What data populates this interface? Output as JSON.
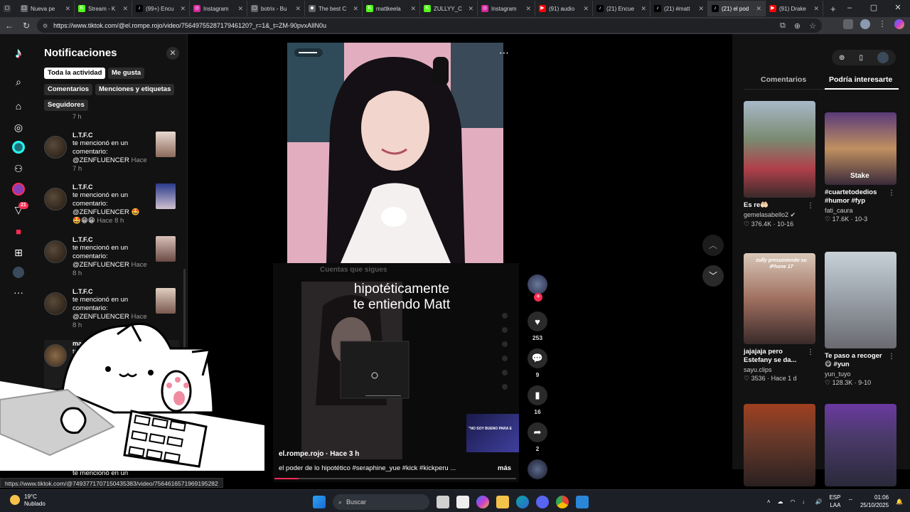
{
  "browser": {
    "tabs": [
      {
        "title": "Nueva pe",
        "color": "#5f6368",
        "glyph": "▢"
      },
      {
        "title": "Stream - K",
        "color": "#53fc18",
        "glyph": "K"
      },
      {
        "title": "(99+) Encu",
        "color": "#000000",
        "glyph": "♪"
      },
      {
        "title": "Instagram",
        "color": "#d6249f",
        "glyph": "◎"
      },
      {
        "title": "botrix - Bu",
        "color": "#5f6368",
        "glyph": "▢"
      },
      {
        "title": "The best C",
        "color": "#5f6368",
        "glyph": "◆"
      },
      {
        "title": "mattkeela",
        "color": "#53fc18",
        "glyph": "K"
      },
      {
        "title": "ZULLYY_C",
        "color": "#53fc18",
        "glyph": "K"
      },
      {
        "title": "Instagram",
        "color": "#d6249f",
        "glyph": "◎"
      },
      {
        "title": "(91) audio",
        "color": "#ff0000",
        "glyph": "▶"
      },
      {
        "title": "(21) Encue",
        "color": "#000000",
        "glyph": "♪"
      },
      {
        "title": "(21) #matt",
        "color": "#000000",
        "glyph": "♪"
      },
      {
        "title": "(21) el pod",
        "color": "#000000",
        "glyph": "♪",
        "active": true
      },
      {
        "title": "(91) Drake",
        "color": "#ff0000",
        "glyph": "▶"
      }
    ],
    "url": "https://www.tiktok.com/@el.rompe.rojo/video/7564975528717946120?_r=1&_t=ZM-90pvxAIlN0u",
    "status_url": "https://www.tiktok.com/@74937717071504353­83/video/7564616571969195282"
  },
  "notifications": {
    "title": "Notificaciones",
    "chips": [
      "Toda la actividad",
      "Me gusta",
      "Comentarios",
      "Menciones y etiquetas",
      "Seguidores"
    ],
    "partial_top": "7 h",
    "items": [
      {
        "name": "L.T.F.C",
        "text": "te mencionó en un comentario: @ZENFLUENCER",
        "time": "Hace 7 h"
      },
      {
        "name": "L.T.F.C",
        "text": "te mencionó en un comentario: @ZENFLUENCER 🤩🤩😁😁",
        "time": "Hace 8 h"
      },
      {
        "name": "L.T.F.C",
        "text": "te mencionó en un comentario: @ZENFLUENCER",
        "time": "Hace 8 h"
      },
      {
        "name": "L.T.F.C",
        "text": "te mencionó en un comentario: @ZENFLUENCER",
        "time": "Hace 8 h"
      },
      {
        "name": "marili",
        "text": "te",
        "time": ""
      }
    ],
    "partial_bottom": "te mencionó en un"
  },
  "video": {
    "caption_line1": "hipotéticamente",
    "caption_line2": "te entiendo Matt",
    "following_heading": "Cuentas que sigues",
    "author": "el.rompe.rojo · Hace 3 h",
    "description": "el poder de lo hipotético #seraphine_yue #kick #kickperu ...",
    "more": "más",
    "progress": 0.1,
    "miniplayer_text": "\"NO SOY BUENO PARA E",
    "likes": "253",
    "comments": "9",
    "saves": "16",
    "shares": "2"
  },
  "right_panel": {
    "tabs": [
      "Comentarios",
      "Podría interesarte"
    ],
    "cards": [
      {
        "title": "Es re🤲🏻",
        "user": "gemelasabello2 ✔",
        "stats": "♡ 376.4K · 10-16"
      },
      {
        "title": "#cuartetodedios #humor #fyp",
        "user": "fati_caura",
        "stats": "♡ 17.6K · 10-3"
      },
      {
        "title": "jajajaja pero Estefany se da...",
        "user": "sayu.clips",
        "stats": "♡ 3536 · Hace 1 d"
      },
      {
        "title": "Te paso a recoger 😋 #yun",
        "user": "yun_tuyo",
        "stats": "♡ 128.3K · 9-10"
      },
      {
        "title": "",
        "user": "",
        "stats": ""
      },
      {
        "title": "",
        "user": "",
        "stats": ""
      }
    ],
    "thumb_texts": [
      "",
      "Stake",
      "zully presumiendo su iPhone 17",
      "",
      "",
      ""
    ]
  },
  "taskbar": {
    "temperature": "19°C",
    "weather": "Nublado",
    "search_placeholder": "Buscar",
    "lang1": "ESP",
    "lang2": "LAA",
    "time": "01:06",
    "date": "25/10/2025"
  },
  "colors": {
    "accent": "#fe2c55",
    "cyan": "#25f4ee"
  }
}
